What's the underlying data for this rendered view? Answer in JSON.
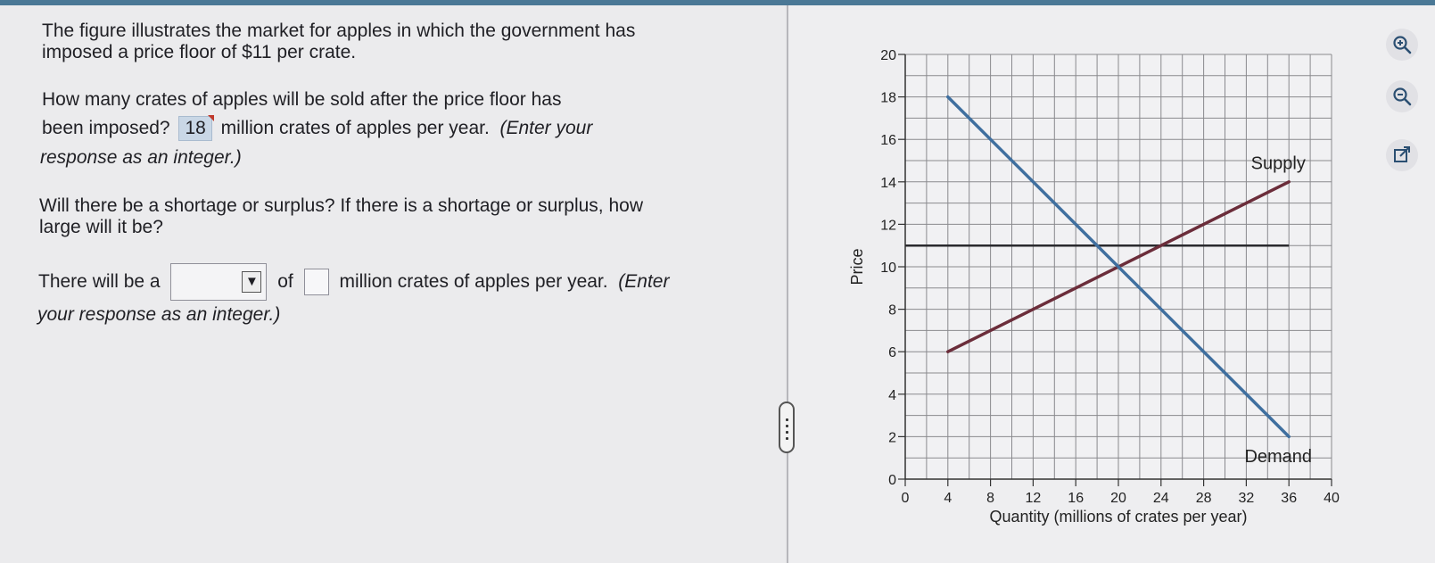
{
  "question": {
    "intro_line1": "The figure illustrates the market for apples in which the government has",
    "intro_line2": "imposed a price floor of $11 per crate.",
    "q1_line1": "How many crates of apples will be sold after the price floor has",
    "q1_line2_before": "been imposed?",
    "q1_answer": "18",
    "q1_line2_after": "million crates of apples per year.",
    "q1_hint_part1": "(Enter your",
    "q1_hint_part2": "response as an integer.)",
    "q2_line1": "Will there be a shortage or surplus?  If there is a shortage or surplus, how",
    "q2_line2": "large will it be?",
    "q3_before": "There will be a",
    "q3_dropdown_value": "",
    "q3_dropdown_arrow": "▼",
    "q3_of": "of",
    "q3_input_value": "",
    "q3_after": "million crates of apples per year.",
    "q3_hint_part1": "(Enter",
    "q3_hint_part2": "your response as an integer.)"
  },
  "toolbar": {
    "zoom_in_icon": "zoom-in-icon",
    "zoom_out_icon": "zoom-out-icon",
    "popout_icon": "external-link-icon"
  },
  "colors": {
    "supply": "#6b2d3a",
    "demand": "#3f6f9f",
    "price_floor": "#2a2a2e",
    "grid": "#8a8a8e",
    "accent": "#4a7896"
  },
  "chart_data": {
    "type": "line",
    "xlabel": "Quantity (millions of crates per year)",
    "ylabel": "Price",
    "xlim": [
      0,
      40
    ],
    "ylim": [
      0,
      20
    ],
    "x_ticks": [
      0,
      4,
      8,
      12,
      16,
      20,
      24,
      28,
      32,
      36,
      40
    ],
    "y_ticks": [
      0,
      2,
      4,
      6,
      8,
      10,
      12,
      14,
      16,
      18,
      20
    ],
    "x_minor_step": 2,
    "y_minor_step": 1,
    "grid": true,
    "series": [
      {
        "name": "Supply",
        "points": [
          [
            4,
            6
          ],
          [
            36,
            14
          ]
        ]
      },
      {
        "name": "Demand",
        "points": [
          [
            4,
            18
          ],
          [
            36,
            2
          ]
        ]
      }
    ],
    "price_floor": {
      "points": [
        [
          0,
          11
        ],
        [
          36,
          11
        ]
      ]
    },
    "labels": [
      {
        "text": "Supply",
        "x": 35,
        "y": 14.6
      },
      {
        "text": "Demand",
        "x": 35,
        "y": 0.8
      }
    ]
  }
}
